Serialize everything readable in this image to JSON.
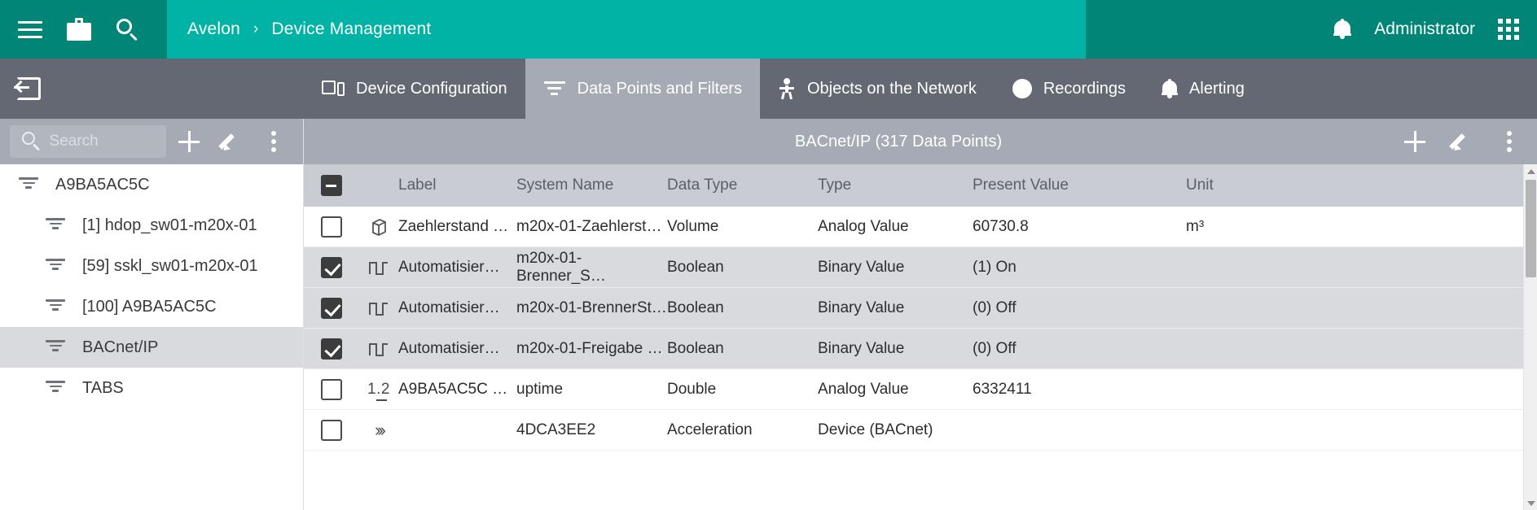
{
  "header": {
    "menu_icon": "hamburger-icon",
    "briefcase_icon": "briefcase-icon",
    "search_icon": "search-icon",
    "breadcrumb": {
      "root": "Avelon",
      "separator": "›",
      "current": "Device Management"
    },
    "notifications_icon": "bell-icon",
    "user": "Administrator",
    "apps_icon": "apps-grid-icon",
    "colors": {
      "brand_dark": "#008577",
      "brand": "#00b3a4",
      "tabbar": "#646873",
      "tab_active": "#a6aab4"
    }
  },
  "tabbar": {
    "back_icon": "back-arrow-icon",
    "tabs": [
      {
        "label": "Device Configuration",
        "icon": "monitor-phone-icon",
        "active": false
      },
      {
        "label": "Data Points and Filters",
        "icon": "filter-icon",
        "active": true
      },
      {
        "label": "Objects on the Network",
        "icon": "person-icon",
        "active": false
      },
      {
        "label": "Recordings",
        "icon": "record-circle-icon",
        "active": false
      },
      {
        "label": "Alerting",
        "icon": "bell-icon",
        "active": false
      }
    ]
  },
  "sidebar": {
    "search": {
      "placeholder": "Search",
      "value": "",
      "icon": "search-icon"
    },
    "actions": [
      {
        "name": "add-button",
        "icon": "plus-icon"
      },
      {
        "name": "edit-button",
        "icon": "pencil-icon"
      },
      {
        "name": "more-button",
        "icon": "kebab-menu-icon"
      }
    ],
    "tree": [
      {
        "label": "A9BA5AC5C",
        "indent": 0,
        "selected": false,
        "icon": "filter-icon"
      },
      {
        "label": "[1] hdop_sw01-m20x-01",
        "indent": 1,
        "selected": false,
        "icon": "filter-icon"
      },
      {
        "label": "[59] sskl_sw01-m20x-01",
        "indent": 1,
        "selected": false,
        "icon": "filter-icon"
      },
      {
        "label": "[100] A9BA5AC5C",
        "indent": 1,
        "selected": false,
        "icon": "filter-icon"
      },
      {
        "label": "BACnet/IP",
        "indent": 1,
        "selected": true,
        "icon": "filter-icon"
      },
      {
        "label": "TABS",
        "indent": 1,
        "selected": false,
        "icon": "filter-icon"
      }
    ]
  },
  "main": {
    "title": "BACnet/IP (317  Data Points)",
    "actions": [
      {
        "name": "add-data-point-button",
        "icon": "plus-icon"
      },
      {
        "name": "edit-data-point-button",
        "icon": "pencil-icon"
      },
      {
        "name": "more-options-button",
        "icon": "kebab-menu-icon"
      }
    ],
    "table": {
      "select_all_state": "indeterminate",
      "columns": [
        "Label",
        "System Name",
        "Data Type",
        "Type",
        "Present Value",
        "Unit"
      ],
      "rows": [
        {
          "checked": false,
          "icon": "cube-icon",
          "zebra": "white",
          "label": "Zaehlerstand …",
          "system_name": "m20x-01-Zaehlerst…",
          "data_type": "Volume",
          "type": "Analog Value",
          "present_value": "60730.8",
          "unit": "m³"
        },
        {
          "checked": true,
          "icon": "pulse-icon",
          "zebra": "alt",
          "label": "Automatisier…",
          "system_name": "m20x-01-Brenner_S…",
          "data_type": "Boolean",
          "type": "Binary Value",
          "present_value": "(1) On",
          "unit": ""
        },
        {
          "checked": true,
          "icon": "pulse-icon",
          "zebra": "alt",
          "label": "Automatisier…",
          "system_name": "m20x-01-BrennerSt…",
          "data_type": "Boolean",
          "type": "Binary Value",
          "present_value": "(0) Off",
          "unit": ""
        },
        {
          "checked": true,
          "icon": "pulse-icon",
          "zebra": "alt",
          "label": "Automatisier…",
          "system_name": "m20x-01-Freigabe …",
          "data_type": "Boolean",
          "type": "Binary Value",
          "present_value": "(0) Off",
          "unit": ""
        },
        {
          "checked": false,
          "icon": "decimal-number-icon",
          "zebra": "white",
          "label": "A9BA5AC5C …",
          "system_name": "uptime",
          "data_type": "Double",
          "type": "Analog Value",
          "present_value": "6332411",
          "unit": ""
        },
        {
          "checked": false,
          "icon": "chevrons-icon",
          "zebra": "white",
          "label": "",
          "system_name": "4DCA3EE2",
          "data_type": "Acceleration",
          "type": "Device (BACnet)",
          "present_value": "",
          "unit": ""
        }
      ]
    },
    "scrollbar": {
      "up_icon": "scroll-up-arrow-icon",
      "down_icon": "scroll-down-arrow-icon"
    }
  }
}
